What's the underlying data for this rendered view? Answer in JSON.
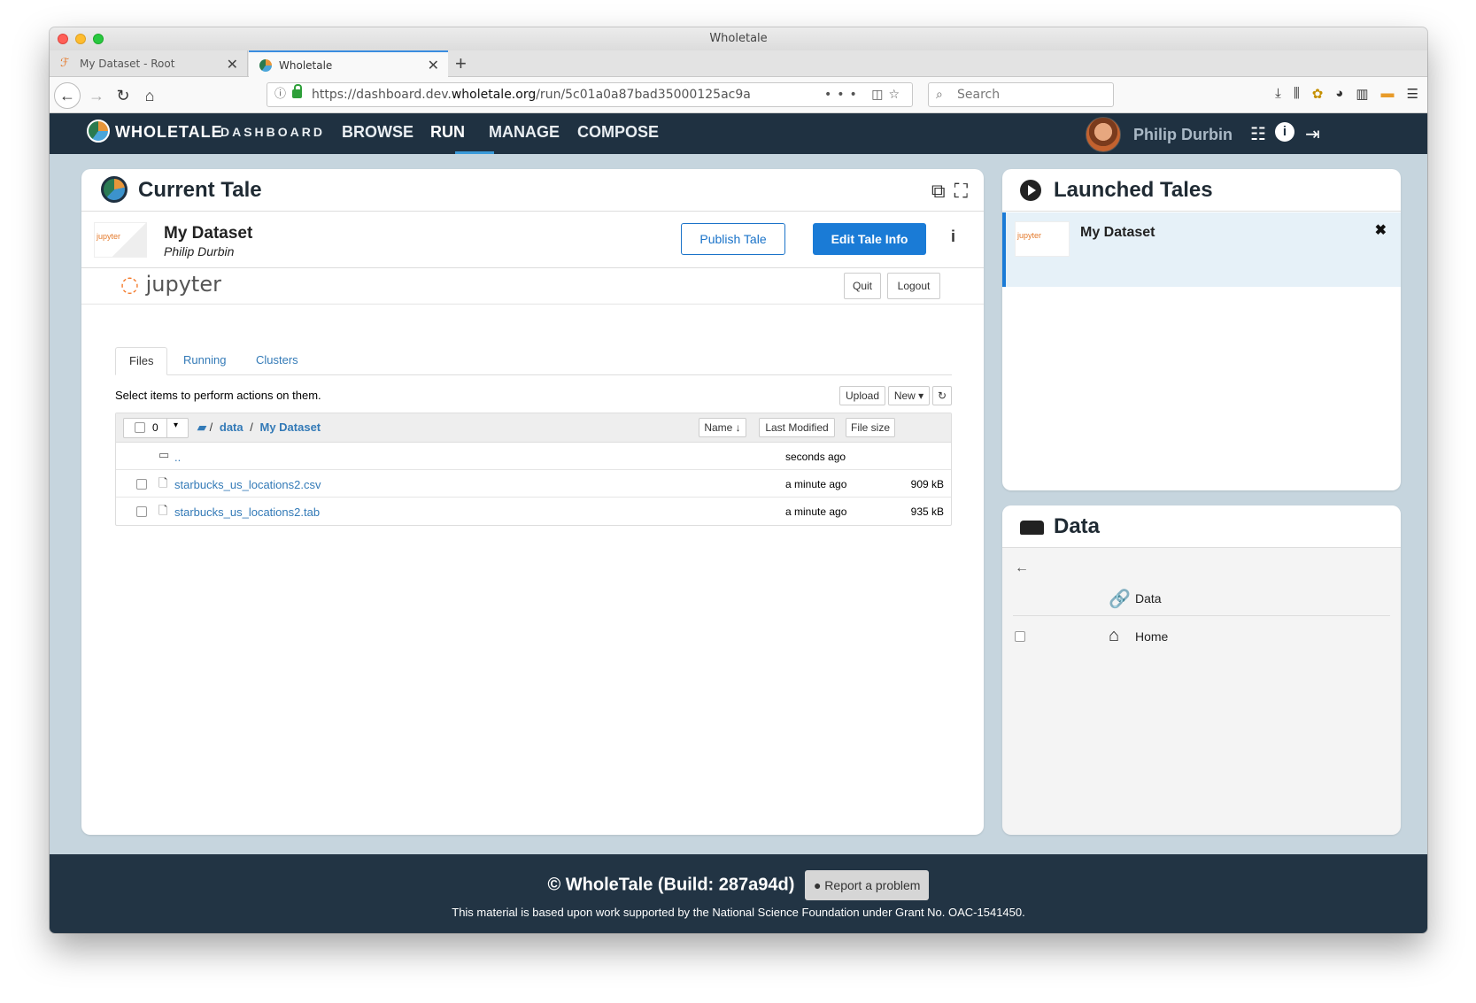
{
  "window": {
    "title": "Wholetale"
  },
  "browser": {
    "tabs": [
      {
        "label": "My Dataset - Root"
      },
      {
        "label": "Wholetale"
      }
    ],
    "url_prefix": "https://dashboard.dev.",
    "url_domain": "wholetale.org",
    "url_path": "/run/5c01a0a87bad35000125ac9a",
    "search_placeholder": "Search"
  },
  "app_nav": {
    "brand": "WHOLETALE",
    "brand_sub": "DASHBOARD",
    "links": [
      "BROWSE",
      "RUN",
      "MANAGE",
      "COMPOSE"
    ],
    "active": "RUN",
    "user": "Philip Durbin"
  },
  "current_tale": {
    "title": "Current Tale",
    "name": "My Dataset",
    "author": "Philip Durbin",
    "publish_label": "Publish Tale",
    "edit_label": "Edit Tale Info",
    "thumb_text": "jupyter"
  },
  "jupyter": {
    "logo": "jupyter",
    "quit_label": "Quit",
    "logout_label": "Logout",
    "tabs": [
      "Files",
      "Running",
      "Clusters"
    ],
    "hint": "Select items to perform actions on them.",
    "upload_label": "Upload",
    "new_label": "New ▾",
    "selected_count": "0",
    "breadcrumb": [
      "data",
      "My Dataset"
    ],
    "columns": {
      "name": "Name",
      "modified": "Last Modified",
      "size": "File size"
    },
    "files": [
      {
        "name": "..",
        "modified": "seconds ago",
        "size": "",
        "type": "folder"
      },
      {
        "name": "starbucks_us_locations2.csv",
        "modified": "a minute ago",
        "size": "909 kB",
        "type": "file"
      },
      {
        "name": "starbucks_us_locations2.tab",
        "modified": "a minute ago",
        "size": "935 kB",
        "type": "file"
      }
    ]
  },
  "launched_tales": {
    "title": "Launched Tales",
    "items": [
      {
        "name": "My Dataset",
        "thumb_text": "jupyter"
      }
    ]
  },
  "data_panel": {
    "title": "Data",
    "items": [
      {
        "label": "Data"
      },
      {
        "label": "Home"
      }
    ]
  },
  "footer": {
    "copyright": "© WholeTale (Build: 287a94d)",
    "report_label": "Report a problem",
    "grant": "This material is based upon work supported by the National Science Foundation under Grant No. OAC-1541450."
  }
}
